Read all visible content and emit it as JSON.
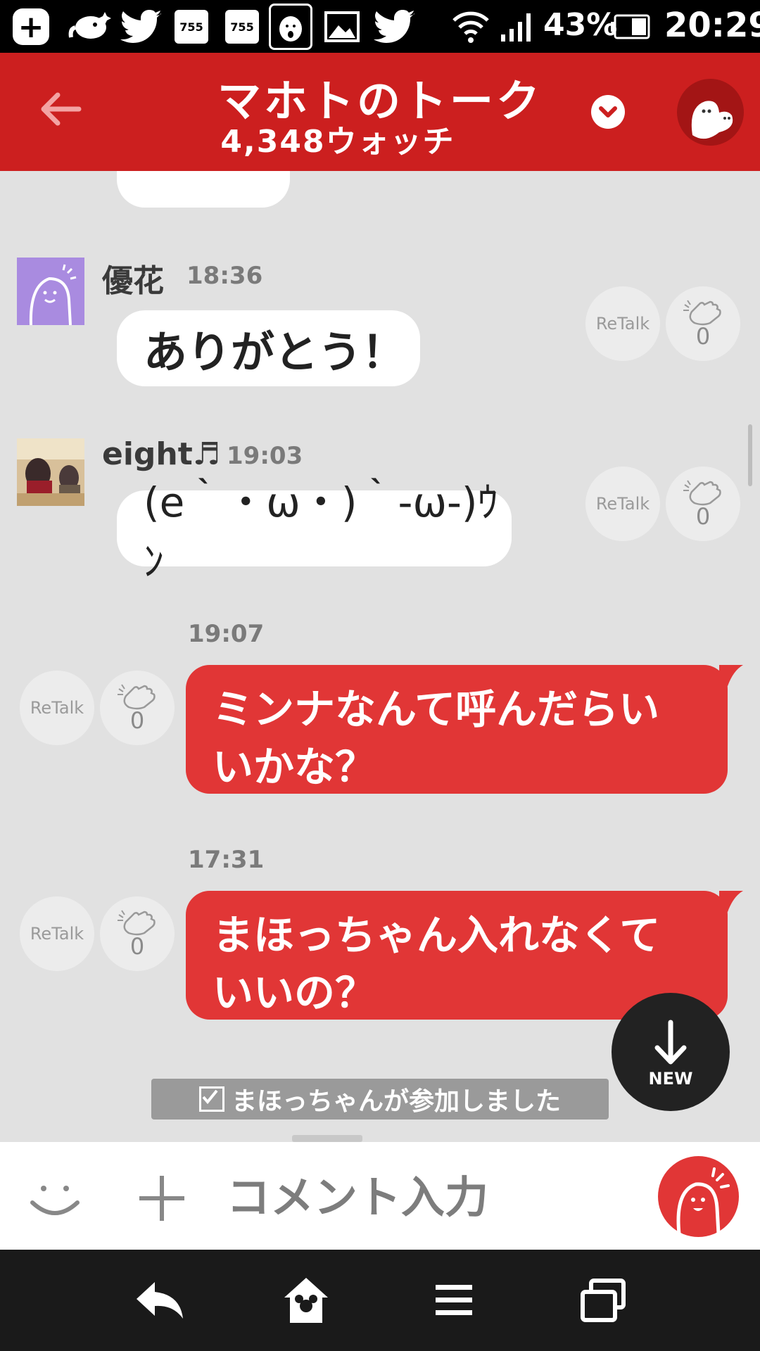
{
  "status_bar": {
    "battery": "43%",
    "time": "20:29",
    "icons": [
      "add-icon",
      "elephant-icon",
      "twitter-icon",
      "755-icon",
      "755-icon",
      "bird-app-icon",
      "image-icon",
      "twitter-icon",
      "wifi-icon",
      "signal-icon",
      "battery-icon"
    ],
    "app_badge_label": "755"
  },
  "header": {
    "title": "マホトのトーク",
    "subtitle": "4,348ウォッチ"
  },
  "messages": [
    {
      "name": "優花",
      "time": "18:36",
      "text": "ありがとう！",
      "retalk": "ReTalk",
      "claps": "0"
    },
    {
      "name": "eight♬",
      "time": "19:03",
      "text": "(e｀・ω・)｀-ω-)ｳﾝ",
      "retalk": "ReTalk",
      "claps": "0"
    }
  ],
  "own_messages": [
    {
      "time": "19:07",
      "line1": "ミンナなんて呼んだらい",
      "line2": "いかな？",
      "retalk": "ReTalk",
      "claps": "0"
    },
    {
      "time": "17:31",
      "line1": "まほっちゃん入れなくて",
      "line2": "いいの？",
      "retalk": "ReTalk",
      "claps": "0"
    }
  ],
  "system_notice": "まほっちゃんが参加しました",
  "new_button_label": "NEW",
  "input": {
    "placeholder": "コメント入力"
  },
  "colors": {
    "brand_red": "#cc1f1f",
    "bubble_red": "#e13636",
    "chat_bg": "#e1e1e1"
  }
}
